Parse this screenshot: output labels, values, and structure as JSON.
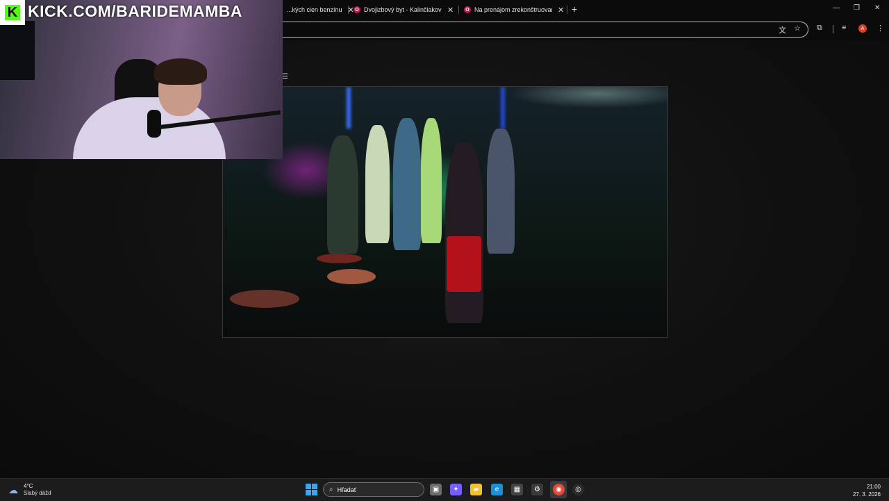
{
  "overlay": {
    "logo_letter": "K",
    "channel_url": "KICK.COM/BARIDEMAMBA"
  },
  "browser": {
    "tabs": [
      {
        "title": "...kých cien benzínu",
        "has_favicon": false,
        "close": "✕"
      },
      {
        "title": "Dvojizbový byt - Kalinčiakova u",
        "favicon": "O",
        "close": "✕"
      },
      {
        "title": "Na prenájom zrekonštruovaný",
        "favicon": "O",
        "close": "✕"
      }
    ],
    "new_tab": "+",
    "window_controls": {
      "minimize": "—",
      "maximize": "❐",
      "close": "✕"
    },
    "toolbar": {
      "translate_icon": "文",
      "bookmark_icon": "☆",
      "extensions_icon": "⧉",
      "media_icon": "≡",
      "profile_letter": "A",
      "menu_icon": "⋮"
    }
  },
  "page": {
    "menu_glyph": "☰"
  },
  "taskbar": {
    "weather": {
      "temp": "4°C",
      "desc": "Slabý dážď",
      "icon": "cloud-rain-icon"
    },
    "search_placeholder": "Hľadať",
    "search_icon": "⌕",
    "apps": [
      {
        "name": "task-view",
        "glyph": "▣",
        "color": "#6b6b6b"
      },
      {
        "name": "copilot",
        "glyph": "✦",
        "color": "#7a5cff"
      },
      {
        "name": "file-explorer",
        "glyph": "▰",
        "color": "#f2c231"
      },
      {
        "name": "edge",
        "glyph": "e",
        "color": "#1d8fd6"
      },
      {
        "name": "store",
        "glyph": "▦",
        "color": "#444444"
      },
      {
        "name": "steam-like",
        "glyph": "⚙",
        "color": "#3a3a3a"
      },
      {
        "name": "chrome",
        "glyph": "◉",
        "color": "#e04a3a"
      },
      {
        "name": "obs",
        "glyph": "◎",
        "color": "#2a2a2a"
      }
    ],
    "clock": {
      "time": "21:00",
      "date": "27. 3. 2026"
    }
  },
  "colors": {
    "kick_green": "#53fc18",
    "tab_favicon": "#c8174a",
    "start_blue": "#39a7f0"
  }
}
